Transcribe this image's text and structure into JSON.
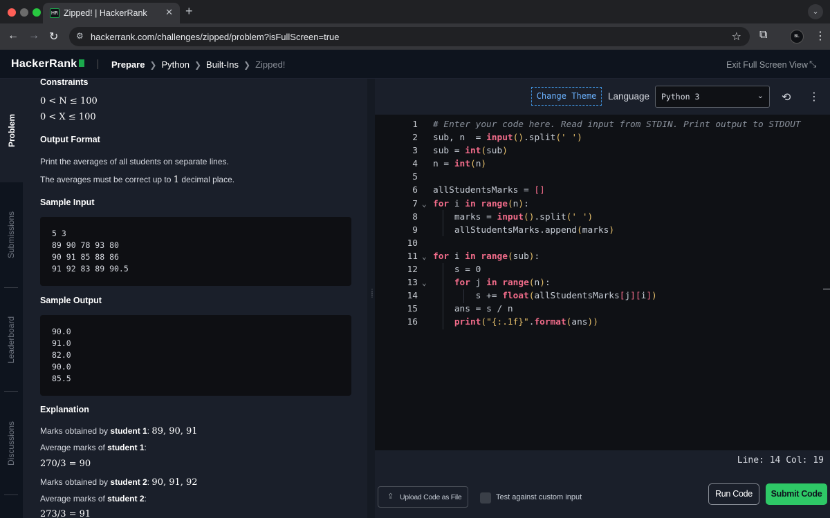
{
  "browser": {
    "tab_title": "Zipped! | HackerRank",
    "url": "hackerrank.com/challenges/zipped/problem?isFullScreen=true",
    "favicon_text": "HR",
    "profile_text": "BL"
  },
  "header": {
    "logo": "HackerRank",
    "breadcrumbs": [
      "Prepare",
      "Python",
      "Built-Ins"
    ],
    "current": "Zipped!",
    "exit_full_screen": "Exit Full Screen View"
  },
  "sidebar": {
    "tabs": [
      "Problem",
      "Submissions",
      "Leaderboard",
      "Discussions"
    ],
    "active": "Problem"
  },
  "problem": {
    "constraints_title": "Constraints",
    "constraint_1": "0 < N ≤ 100",
    "constraint_2": "0 < X ≤ 100",
    "output_format_title": "Output Format",
    "output_format_text": "Print the averages of all students on separate lines.",
    "precision_before": "The averages must be correct up to",
    "precision_number": "1",
    "precision_after": "decimal place.",
    "sample_input_title": "Sample Input",
    "sample_input": "5 3\n89 90 78 93 80\n90 91 85 88 86\n91 92 83 89 90.5",
    "sample_output_title": "Sample Output",
    "sample_output": "90.0\n91.0\n82.0\n90.0\n85.5",
    "explanation_title": "Explanation",
    "exp1_prefix": "Marks obtained by",
    "exp1_student": "student 1",
    "exp1_marks": "89, 90, 91",
    "exp2_prefix": "Average marks of",
    "exp2_student": "student 1",
    "exp3_math": "270/3 = 90",
    "exp4_prefix": "Marks obtained by",
    "exp4_student": "student 2",
    "exp4_marks": "90, 91, 92",
    "exp5_prefix": "Average marks of",
    "exp5_student": "student 2",
    "exp6_math": "273/3 = 91"
  },
  "editor": {
    "change_theme": "Change Theme",
    "language_label": "Language",
    "language_value": "Python 3",
    "status": "Line: 14 Col: 19",
    "line_numbers": [
      "1",
      "2",
      "3",
      "4",
      "5",
      "6",
      "7",
      "8",
      "9",
      "10",
      "11",
      "12",
      "13",
      "14",
      "15",
      "16"
    ],
    "code_lines": [
      "# Enter your code here. Read input from STDIN. Print output to STDOUT",
      "sub, n  = input().split(' ')",
      "sub = int(sub)",
      "n = int(n)",
      "",
      "allStudentsMarks = []",
      "for i in range(n):",
      "    marks = input().split(' ')",
      "    allStudentsMarks.append(marks)",
      "",
      "for i in range(sub):",
      "    s = 0",
      "    for j in range(n):",
      "        s += float(allStudentsMarks[j][i])",
      "    ans = s / n",
      "    print(\"{:.1f}\".format(ans))"
    ]
  },
  "actions": {
    "upload": "Upload Code as File",
    "custom_input": "Test against custom input",
    "run": "Run Code",
    "submit": "Submit Code"
  },
  "colors": {
    "accent_green": "#2ec866",
    "keyword_pink": "#f26c8a",
    "string_yellow": "#e7c06b",
    "link_blue": "#6bb2ff"
  }
}
